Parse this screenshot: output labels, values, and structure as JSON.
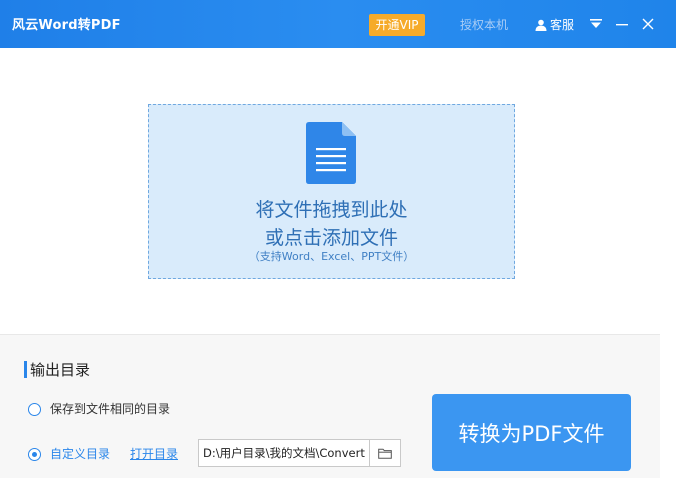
{
  "titlebar": {
    "app_title": "风云Word转PDF",
    "vip_label": "开通VIP",
    "auth_label": "授权本机",
    "service_label": "客服"
  },
  "drop_zone": {
    "line1": "将文件拖拽到此处",
    "line2": "或点击添加文件",
    "hint": "（支持Word、Excel、PPT文件）"
  },
  "output": {
    "section_title": "输出目录",
    "option_same_dir": "保存到文件相同的目录",
    "option_custom_dir": "自定义目录",
    "selected_option": "custom",
    "open_dir_label": "打开目录",
    "path_value": "D:\\用户目录\\我的文档\\ConvertPDF"
  },
  "convert_button_label": "转换为PDF文件",
  "icons": {
    "user": "user-icon",
    "menu": "dropdown-menu-icon",
    "minimize": "minimize-icon",
    "close": "close-icon",
    "document": "document-icon",
    "folder": "folder-icon"
  },
  "colors": {
    "titlebar": "#2688ee",
    "vip": "#f6ab2a",
    "accent": "#2a86ea",
    "drop_zone_bg": "#d9ebfb",
    "convert_button": "#3b96f1"
  }
}
